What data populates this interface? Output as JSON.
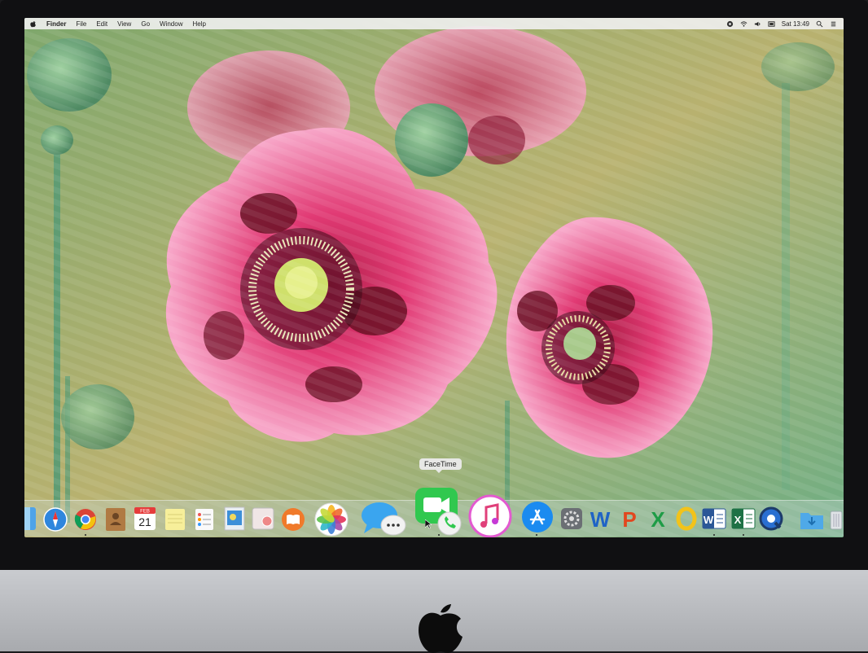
{
  "menubar": {
    "apple_icon": "apple-icon",
    "items": [
      "Finder",
      "File",
      "Edit",
      "View",
      "Go",
      "Window",
      "Help"
    ],
    "clock": "Sat 13:49",
    "status_icons": [
      "cloud-icon",
      "wifi-icon",
      "volume-icon",
      "battery-icon",
      "search-icon",
      "list-icon"
    ]
  },
  "dock": {
    "tooltip": "FaceTime",
    "calendar_month": "FEB",
    "calendar_day": "21",
    "apps": [
      "finder-icon",
      "safari-icon",
      "chrome-icon",
      "contacts-icon",
      "calendar-icon",
      "notes-icon",
      "reminders-icon",
      "preview-icon",
      "photo-booth-icon",
      "books-icon",
      "photos-icon",
      "messages-icon",
      "facetime-icon",
      "itunes-icon",
      "app-store-icon",
      "system-preferences-icon",
      "wps-writer-icon",
      "wps-presentation-icon",
      "wps-spreadsheets-icon",
      "openoffice-icon",
      "word-icon",
      "excel-icon",
      "quicktime-icon",
      "downloads-folder-icon",
      "trash-icon"
    ]
  },
  "colors": {
    "menubar": "#f0f0f0",
    "poppy": "#e43d7e",
    "stem": "#5f9c73",
    "background": "#7fae6f"
  }
}
